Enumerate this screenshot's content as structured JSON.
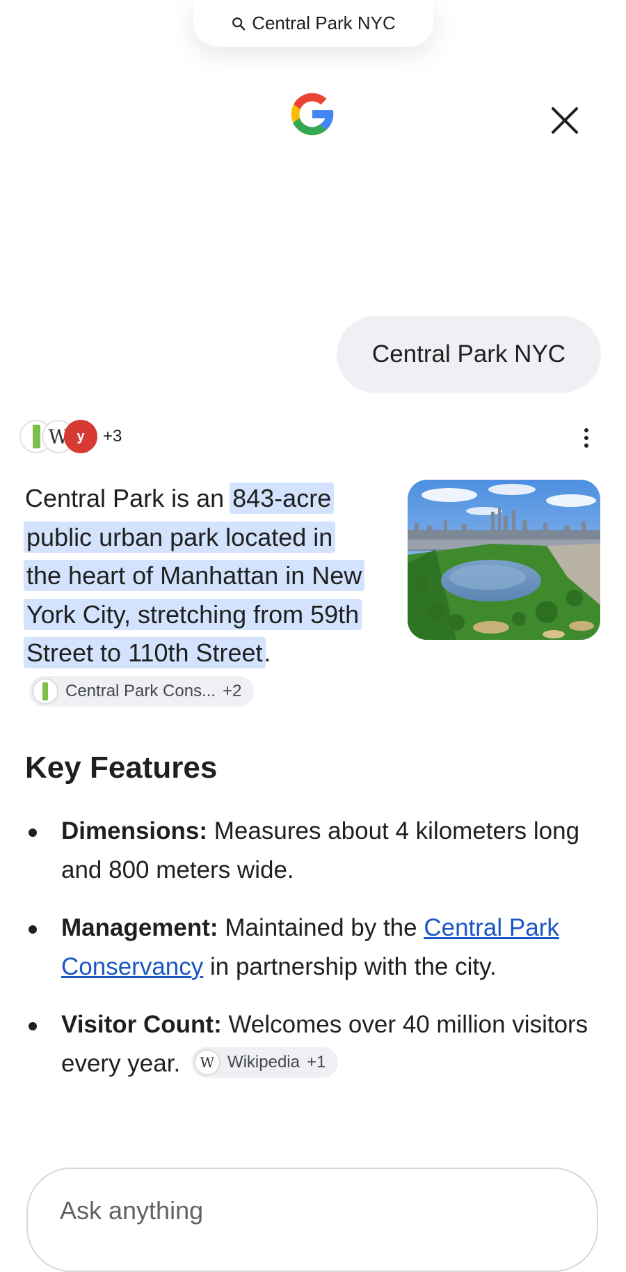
{
  "search_pill": {
    "text": "Central Park NYC",
    "icon": "search-icon"
  },
  "header": {
    "logo": "google-g-logo",
    "close_icon": "close-icon"
  },
  "query": {
    "text": "Central Park NYC"
  },
  "sources": {
    "icons": [
      "conservancy-favicon",
      "wikipedia-favicon",
      "red-site-favicon"
    ],
    "more": "+3"
  },
  "answer": {
    "prefix": "Central Park is an ",
    "highlight": "843-acre public urban park located in the heart of Manhattan in New York City, stretching from 59th Street to 110th Street",
    "suffix": ".",
    "chip": {
      "label": "Central Park Cons...",
      "count": "+2"
    },
    "image_alt": "aerial-view-central-park-reservoir"
  },
  "features": {
    "title": "Key Features",
    "items": [
      {
        "label": "Dimensions:",
        "text": " Measures about 4 kilometers long and 800 meters wide."
      },
      {
        "label": "Management:",
        "text_before": " Maintained by the ",
        "link": "Central Park Conservancy",
        "text_after": " in partnership with the city."
      },
      {
        "label": "Visitor Count:",
        "text": " Welcomes over 40 million visitors every year.",
        "chip": {
          "label": "Wikipedia",
          "count": "+1"
        }
      }
    ]
  },
  "ask": {
    "placeholder": "Ask anything"
  },
  "colors": {
    "highlight": "#d3e3fd",
    "link": "#1a56c4",
    "bubble": "#eef0f4"
  }
}
